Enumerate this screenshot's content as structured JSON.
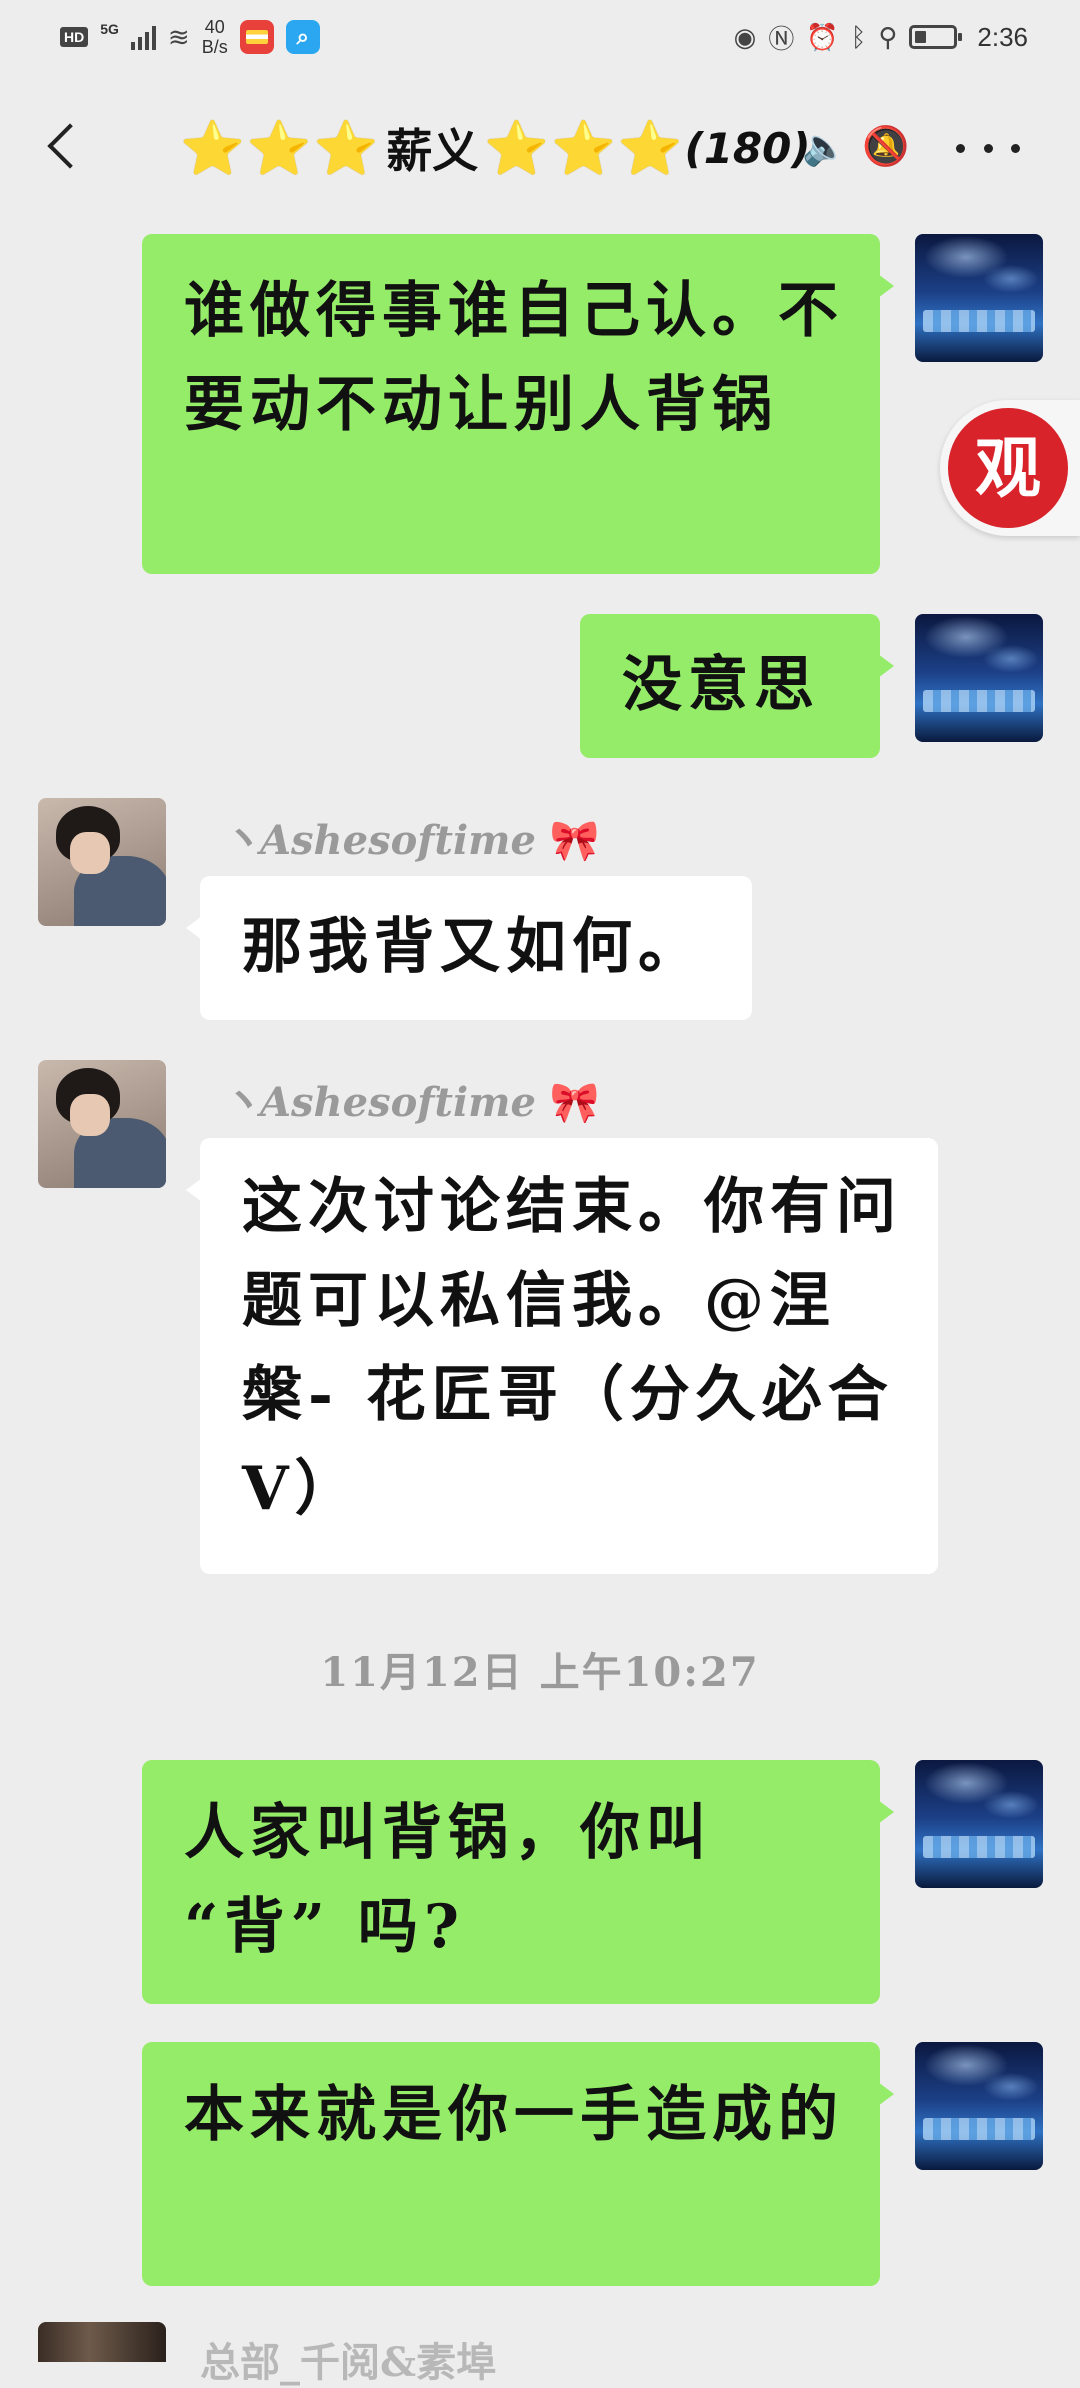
{
  "status_bar": {
    "hd": "HD",
    "network": "5G",
    "speed_value": "40",
    "speed_unit": "B/s",
    "time": "2:36",
    "battery_level": 0.3
  },
  "header": {
    "stars_left": "⭐⭐⭐",
    "group_name": "薪义",
    "stars_right": "⭐⭐⭐",
    "member_count": "(180)"
  },
  "side_badge": "观",
  "messages": [
    {
      "side": "self",
      "text": "谁做得事谁自己认。不要动不动让别人背锅"
    },
    {
      "side": "self",
      "text": "没意思"
    },
    {
      "side": "other",
      "sender": "丶Ashesoftime",
      "sender_badge": "🎀",
      "text": "那我背又如何。"
    },
    {
      "side": "other",
      "sender": "丶Ashesoftime",
      "sender_badge": "🎀",
      "text": "这次讨论结束。你有问题可以私信我。@涅槃- 花匠哥（分久必合V）"
    },
    {
      "side": "self",
      "text": "人家叫背锅，你叫 “背” 吗?"
    },
    {
      "side": "self",
      "text": "本来就是你一手造成的"
    }
  ],
  "timestamp": "11月12日 上午10:27",
  "partial_sender": "总部_千阅&素埠"
}
